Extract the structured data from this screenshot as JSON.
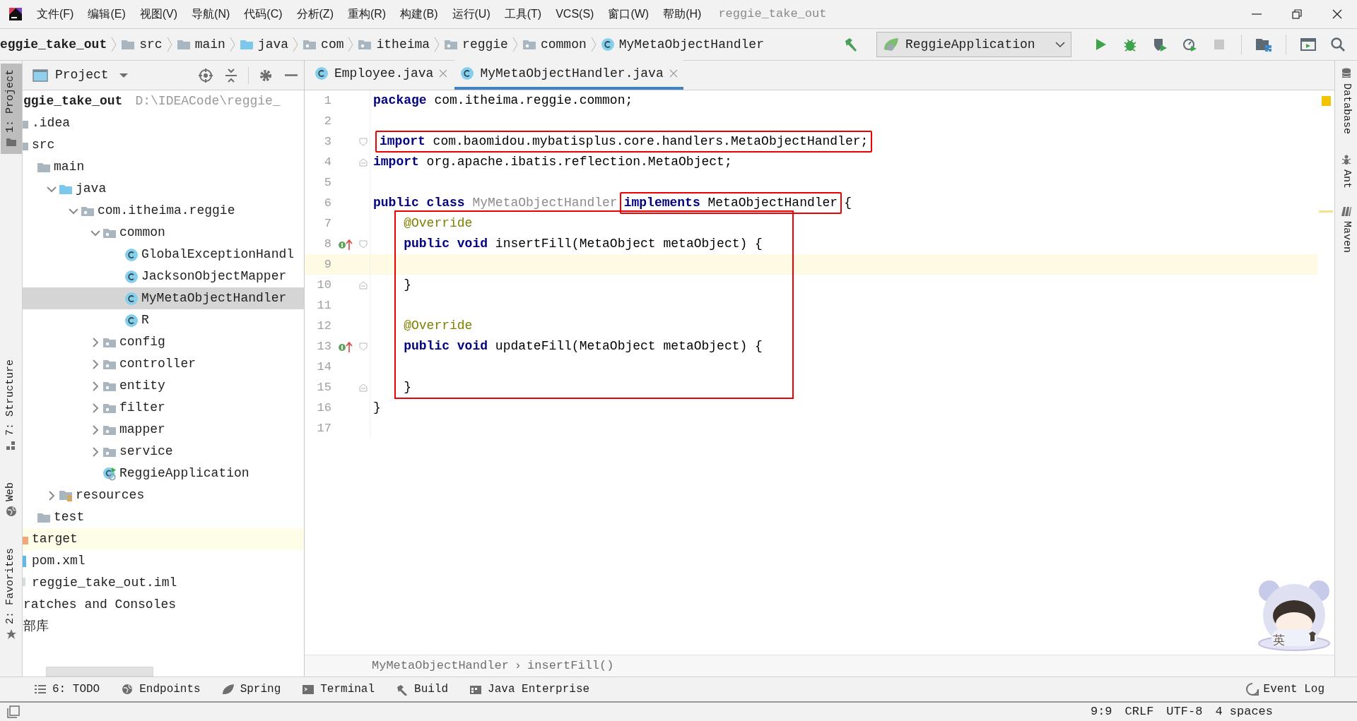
{
  "window": {
    "title": "reggie_take_out"
  },
  "menu": [
    {
      "label": "文件(F)"
    },
    {
      "label": "编辑(E)"
    },
    {
      "label": "视图(V)"
    },
    {
      "label": "导航(N)"
    },
    {
      "label": "代码(C)"
    },
    {
      "label": "分析(Z)"
    },
    {
      "label": "重构(R)"
    },
    {
      "label": "构建(B)"
    },
    {
      "label": "运行(U)"
    },
    {
      "label": "工具(T)"
    },
    {
      "label": "VCS(S)"
    },
    {
      "label": "窗口(W)"
    },
    {
      "label": "帮助(H)"
    }
  ],
  "breadcrumbs": [
    {
      "label": "eggie_take_out",
      "kind": "project"
    },
    {
      "label": "src",
      "kind": "folder"
    },
    {
      "label": "main",
      "kind": "folder"
    },
    {
      "label": "java",
      "kind": "source-folder"
    },
    {
      "label": "com",
      "kind": "package"
    },
    {
      "label": "itheima",
      "kind": "package"
    },
    {
      "label": "reggie",
      "kind": "package"
    },
    {
      "label": "common",
      "kind": "package"
    },
    {
      "label": "MyMetaObjectHandler",
      "kind": "class"
    }
  ],
  "run_toolbar": {
    "configuration": "ReggieApplication",
    "stop_enabled": false
  },
  "left_stripe": [
    {
      "label": "1: Project",
      "selected": true
    },
    {
      "label": "7: Structure",
      "selected": false
    },
    {
      "label": "Web",
      "selected": false
    },
    {
      "label": "2: Favorites",
      "selected": false
    }
  ],
  "right_stripe": [
    {
      "label": "Database"
    },
    {
      "label": "Ant"
    },
    {
      "label": "Maven"
    }
  ],
  "project_panel": {
    "title": "Project",
    "tree": [
      {
        "label": "ggie_take_out",
        "kind": "project",
        "path": "D:\\IDEACode\\reggie_",
        "selected": false,
        "children": [
          {
            "label": ".idea",
            "kind": "folder",
            "selected": false
          },
          {
            "label": "src",
            "kind": "folder",
            "selected": false,
            "children": [
              {
                "label": "main",
                "kind": "folder",
                "selected": false,
                "children": [
                  {
                    "label": "java",
                    "kind": "source-folder",
                    "expanded": true,
                    "selected": false,
                    "children": [
                      {
                        "label": "com.itheima.reggie",
                        "kind": "package",
                        "expanded": true,
                        "selected": false,
                        "children": [
                          {
                            "label": "common",
                            "kind": "package",
                            "expanded": true,
                            "selected": false,
                            "children": [
                              {
                                "label": "GlobalExceptionHandl",
                                "kind": "class",
                                "selected": false
                              },
                              {
                                "label": "JacksonObjectMapper",
                                "kind": "class",
                                "selected": false
                              },
                              {
                                "label": "MyMetaObjectHandler",
                                "kind": "class",
                                "selected": true
                              },
                              {
                                "label": "R",
                                "kind": "class",
                                "selected": false
                              }
                            ]
                          },
                          {
                            "label": "config",
                            "kind": "package",
                            "expanded": false,
                            "selected": false
                          },
                          {
                            "label": "controller",
                            "kind": "package",
                            "expanded": false,
                            "selected": false
                          },
                          {
                            "label": "entity",
                            "kind": "package",
                            "expanded": false,
                            "selected": false
                          },
                          {
                            "label": "filter",
                            "kind": "package",
                            "expanded": false,
                            "selected": false
                          },
                          {
                            "label": "mapper",
                            "kind": "package",
                            "expanded": false,
                            "selected": false
                          },
                          {
                            "label": "service",
                            "kind": "package",
                            "expanded": false,
                            "selected": false
                          },
                          {
                            "label": "ReggieApplication",
                            "kind": "app-class",
                            "selected": false
                          }
                        ]
                      }
                    ]
                  },
                  {
                    "label": "resources",
                    "kind": "resources-folder",
                    "expanded": false,
                    "selected": false
                  }
                ]
              },
              {
                "label": "test",
                "kind": "folder",
                "selected": false
              }
            ]
          },
          {
            "label": "target",
            "kind": "excluded-folder",
            "selected": false
          },
          {
            "label": "pom.xml",
            "kind": "maven-file",
            "selected": false
          },
          {
            "label": "reggie_take_out.iml",
            "kind": "module-file",
            "selected": false
          }
        ]
      },
      {
        "label": "ratches and Consoles",
        "kind": "plain",
        "selected": false
      },
      {
        "label": "部库",
        "kind": "plain",
        "selected": false
      }
    ]
  },
  "tabs": [
    {
      "label": "Employee.java",
      "selected": false
    },
    {
      "label": "MyMetaObjectHandler.java",
      "selected": true
    }
  ],
  "code_lines": [
    {
      "number": "1",
      "segments": [
        {
          "kind": "keyword",
          "text": "package"
        },
        {
          "kind": "plain",
          "text": " com.itheima.reggie.common;"
        }
      ]
    },
    {
      "number": "2"
    },
    {
      "number": "3",
      "fold_start": true,
      "segments": [
        {
          "kind": "box",
          "segments": [
            {
              "kind": "keyword",
              "text": "import"
            },
            {
              "kind": "plain",
              "text": " com.baomidou.mybatisplus.core.handlers.MetaObjectHandler;"
            }
          ]
        }
      ]
    },
    {
      "number": "4",
      "fold_end": true,
      "segments": [
        {
          "kind": "keyword",
          "text": "import"
        },
        {
          "kind": "plain",
          "text": " org.apache.ibatis.reflection.MetaObject;"
        }
      ]
    },
    {
      "number": "5"
    },
    {
      "number": "6",
      "segments": [
        {
          "kind": "keyword",
          "text": "public class"
        },
        {
          "kind": "unused",
          "text": " MyMetaObjectHandler"
        },
        {
          "kind": "box",
          "segments": [
            {
              "kind": "keyword",
              "text": "implements"
            },
            {
              "kind": "plain",
              "text": " MetaObjectHandler"
            }
          ]
        },
        {
          "kind": "plain",
          "text": "{"
        }
      ]
    },
    {
      "number": "7",
      "in_box": true,
      "segments": [
        {
          "kind": "annotation",
          "text": "    @Override"
        }
      ]
    },
    {
      "number": "8",
      "in_box": true,
      "implements_marker": true,
      "fold_start": true,
      "segments": [
        {
          "kind": "keyword",
          "text": "    public void"
        },
        {
          "kind": "plain",
          "text": " insertFill(MetaObject metaObject) {"
        }
      ]
    },
    {
      "number": "9",
      "in_box": true,
      "current": true
    },
    {
      "number": "10",
      "in_box": true,
      "fold_end": true,
      "segments": [
        {
          "kind": "plain",
          "text": "    }"
        }
      ]
    },
    {
      "number": "11",
      "in_box": true
    },
    {
      "number": "12",
      "in_box": true,
      "segments": [
        {
          "kind": "annotation",
          "text": "    @Override"
        }
      ]
    },
    {
      "number": "13",
      "in_box": true,
      "implements_marker": true,
      "fold_start": true,
      "segments": [
        {
          "kind": "keyword",
          "text": "    public void"
        },
        {
          "kind": "plain",
          "text": " updateFill(MetaObject metaObject) {"
        }
      ]
    },
    {
      "number": "14",
      "in_box": true
    },
    {
      "number": "15",
      "in_box": true,
      "fold_end": true,
      "segments": [
        {
          "kind": "plain",
          "text": "    }"
        }
      ]
    },
    {
      "number": "16",
      "segments": [
        {
          "kind": "plain",
          "text": "}"
        }
      ]
    },
    {
      "number": "17"
    }
  ],
  "editor_breadcrumb": {
    "items": [
      "MyMetaObjectHandler",
      "insertFill()"
    ],
    "separator": "›"
  },
  "ime_widget": {
    "mode": "英"
  },
  "tool_windows": [
    {
      "label": "6: TODO",
      "kind": "list"
    },
    {
      "label": "Endpoints",
      "kind": "globe"
    },
    {
      "label": "Spring",
      "kind": "leaf"
    },
    {
      "label": "Terminal",
      "kind": "terminal"
    },
    {
      "label": "Build",
      "kind": "hammer"
    },
    {
      "label": "Java Enterprise",
      "kind": "enterprise"
    }
  ],
  "event_log": {
    "label": "Event Log"
  },
  "status_bar": {
    "items": [
      "9:9",
      "CRLF",
      "UTF-8",
      "4 spaces"
    ]
  }
}
